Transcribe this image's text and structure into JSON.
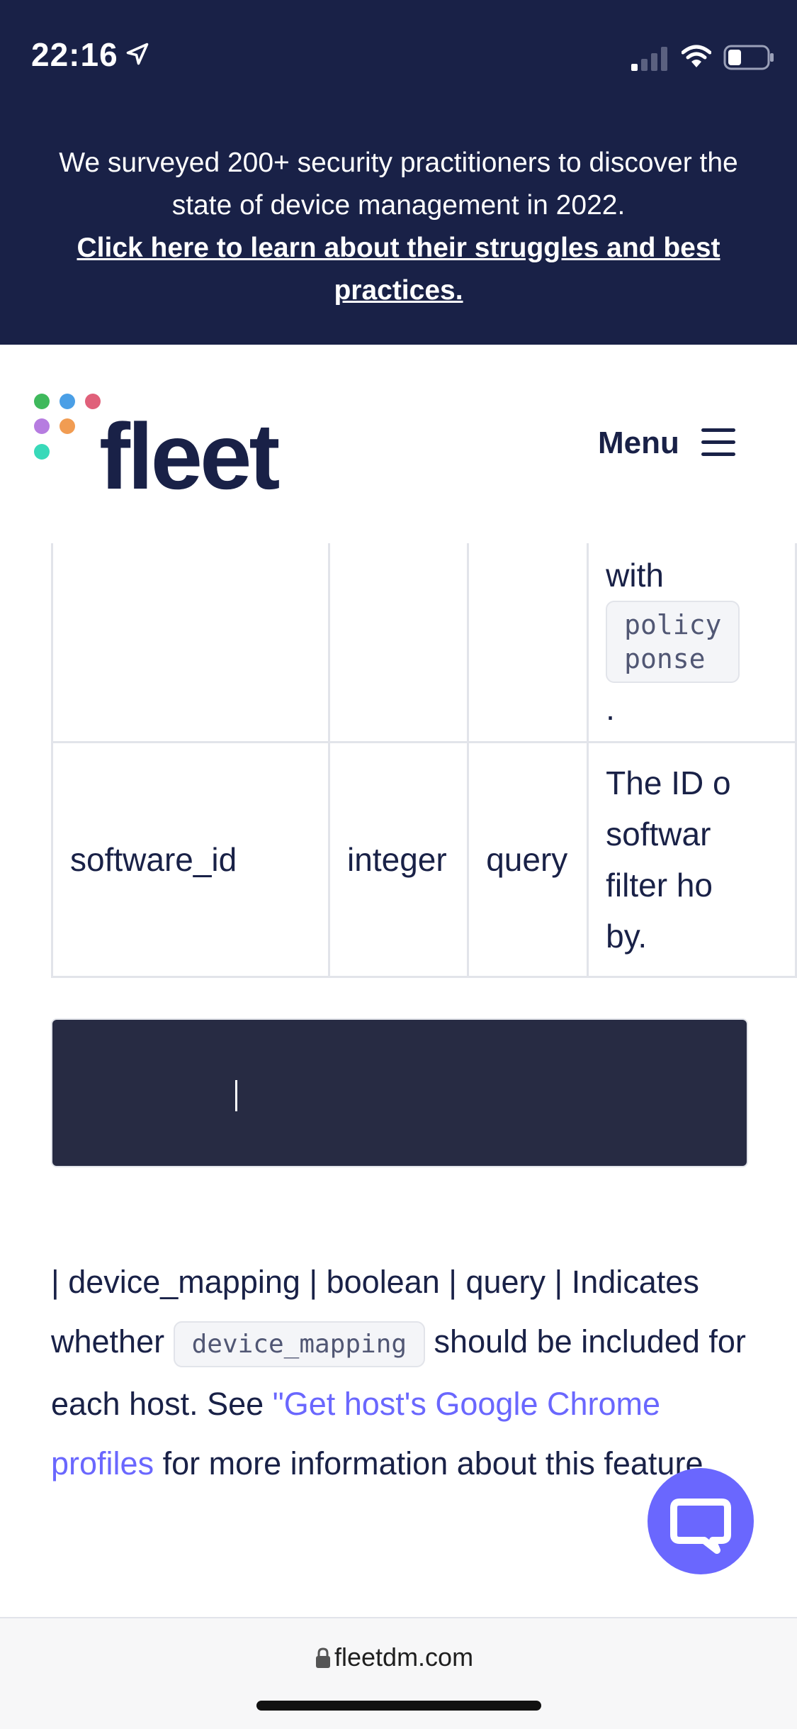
{
  "status_bar": {
    "time": "22:16"
  },
  "banner": {
    "text_line1": "We surveyed 200+ security practitioners to discover the",
    "text_line2": "state of device management in 2022.",
    "link": "Click here to learn about their struggles and best practices."
  },
  "header": {
    "logo": "fleet",
    "menu_label": "Menu"
  },
  "table": {
    "row1": {
      "desc_line1": "with",
      "code_line1": "policy",
      "code_line2": "ponse",
      "desc_end": "."
    },
    "row2": {
      "name": "software_id",
      "type": "integer",
      "in": "query",
      "desc_line1": "The ID o",
      "desc_line2": "softwar",
      "desc_line3": "filter ho",
      "desc_line4": "by."
    }
  },
  "paragraph": {
    "part1": "| device_mapping | boolean | query | Indicates whether ",
    "code": "device_mapping",
    "part2": " should be included for each host. See ",
    "link": "\"Get host's Google Chrome profiles",
    "part3": " for more information about this feature."
  },
  "url_bar": {
    "url": "fleetdm.com"
  },
  "colors": {
    "navy": "#192147",
    "accent": "#6a67fe",
    "code_bg": "#272b43"
  }
}
